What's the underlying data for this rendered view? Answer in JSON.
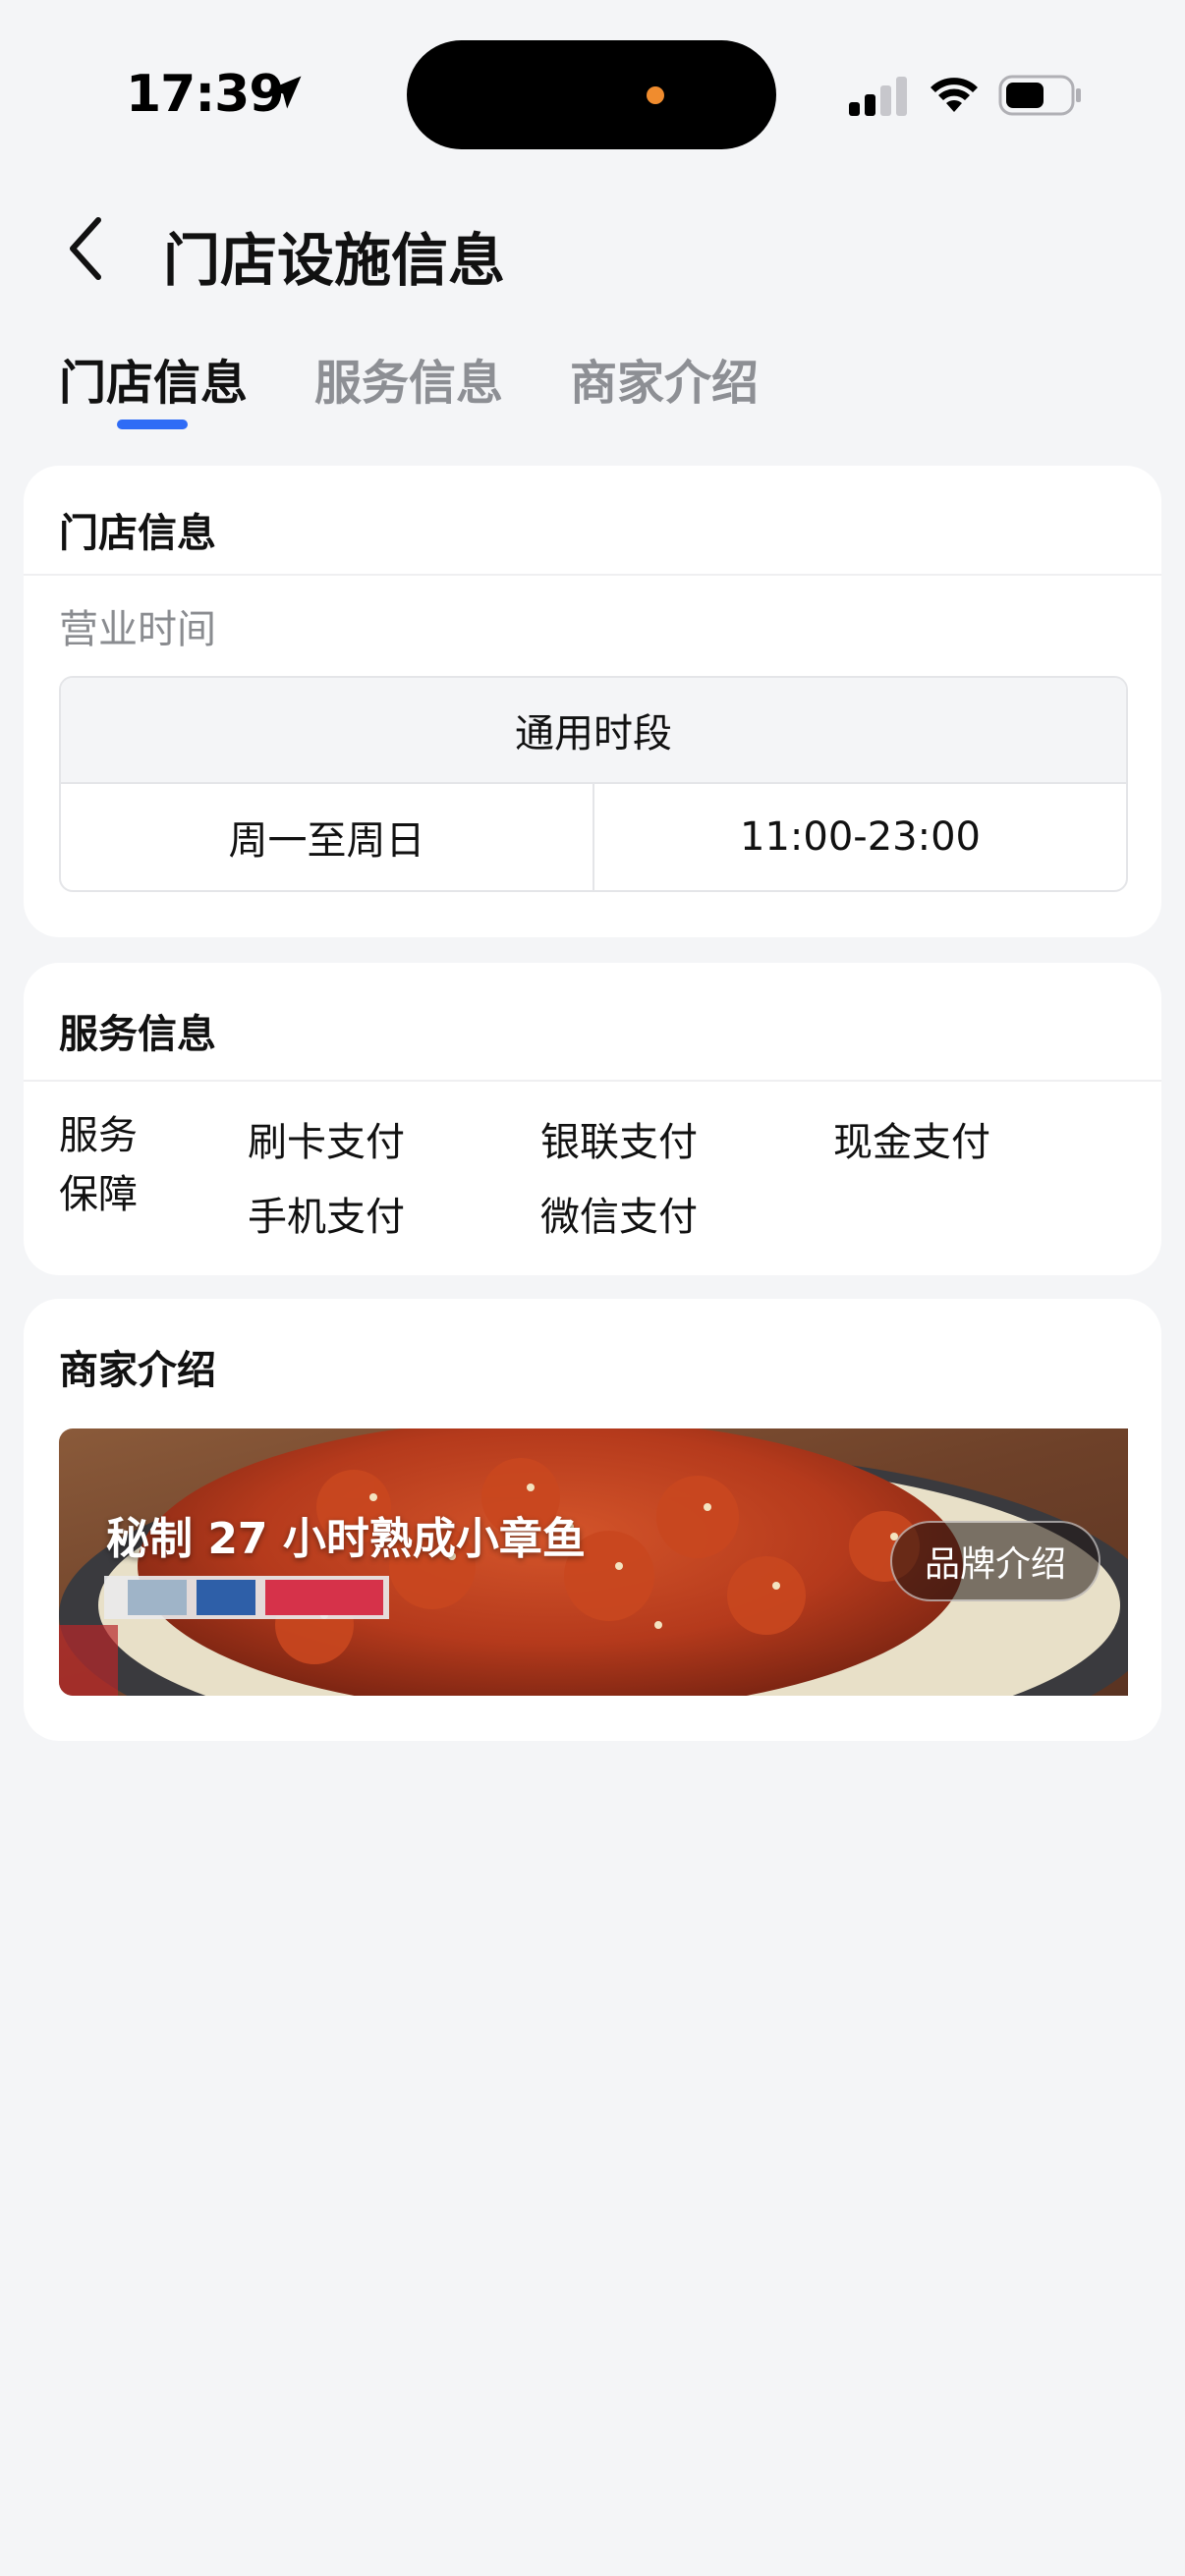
{
  "status_bar": {
    "time": "17:39"
  },
  "header": {
    "title": "门店设施信息"
  },
  "tabs": [
    {
      "label": "门店信息",
      "active": true
    },
    {
      "label": "服务信息",
      "active": false
    },
    {
      "label": "商家介绍",
      "active": false
    }
  ],
  "store_info": {
    "title": "门店信息",
    "hours_label": "营业时间",
    "table": {
      "header": "通用时段",
      "rows": [
        {
          "days": "周一至周日",
          "time": "11:00-23:00"
        }
      ]
    }
  },
  "service_info": {
    "title": "服务信息",
    "guarantee_label": "服务保障",
    "items": [
      "刷卡支付",
      "银联支付",
      "现金支付",
      "手机支付",
      "微信支付"
    ]
  },
  "merchant": {
    "title": "商家介绍",
    "banner_text": "秘制 27 小时熟成小章鱼",
    "brand_button": "品牌介绍"
  },
  "colors": {
    "accent": "#2f6cf6",
    "background": "#f4f5f7",
    "card": "#ffffff",
    "text_primary": "#111111",
    "text_secondary": "#8a8c90"
  }
}
